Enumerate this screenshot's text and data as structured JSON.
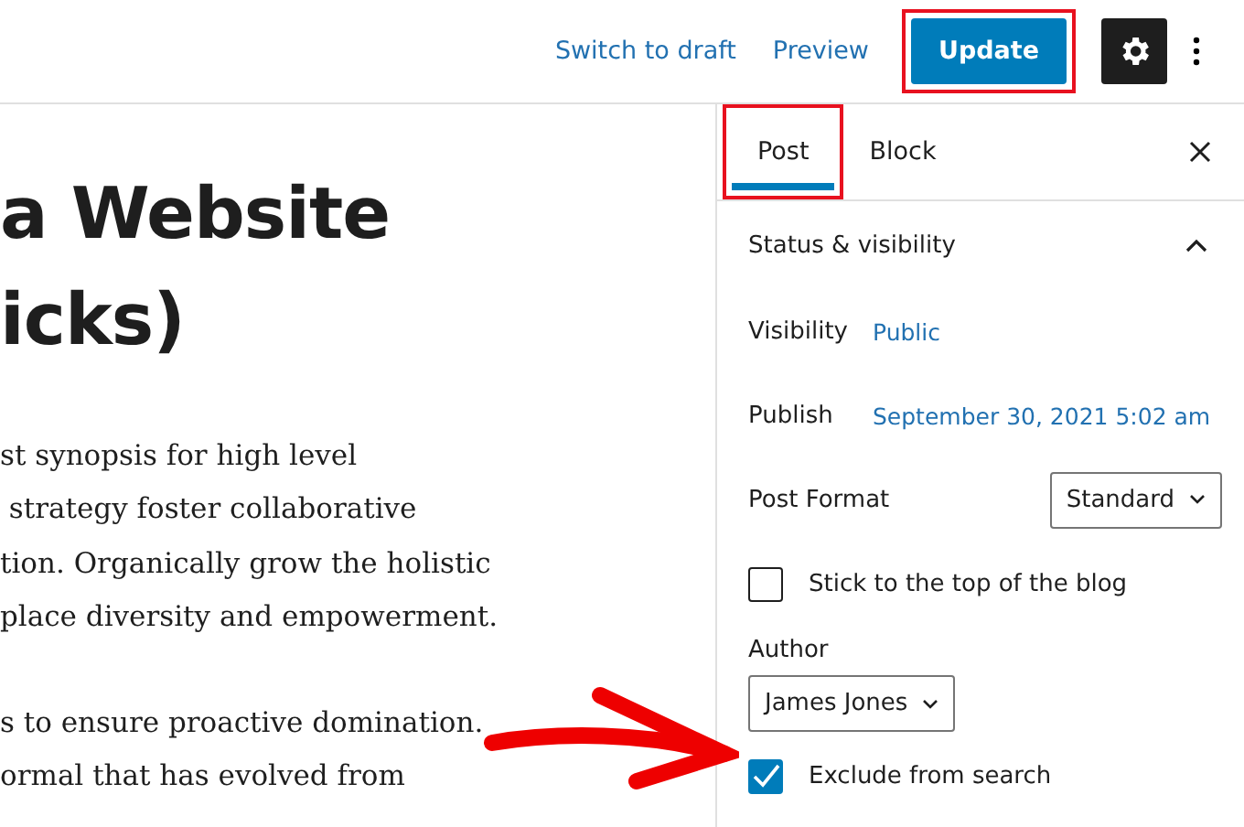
{
  "toolbar": {
    "links": [
      {
        "label": "Switch to draft"
      },
      {
        "label": "Preview"
      }
    ],
    "primary_button": {
      "label": "Update",
      "highlighted": true
    },
    "settings_button": {
      "selected": true
    }
  },
  "editor": {
    "title_lines": [
      "a Website",
      "icks)"
    ],
    "paragraphs": [
      [
        "st synopsis for high level",
        " strategy foster collaborative",
        "tion. Organically grow the holistic",
        "place diversity and empowerment."
      ],
      [
        "s to ensure proactive domination.",
        "ormal that has evolved from"
      ]
    ]
  },
  "sidebar": {
    "tabs": [
      {
        "label": "Post",
        "selected": true,
        "highlighted": true
      },
      {
        "label": "Block",
        "selected": false,
        "highlighted": false
      }
    ],
    "panel": {
      "title": "Status & visibility",
      "expanded": true,
      "rows": [
        {
          "kind": "link",
          "label": "Visibility",
          "value": "Public"
        },
        {
          "kind": "link",
          "label": "Publish",
          "value": "September 30, 2021 5:02 am"
        },
        {
          "kind": "select",
          "label": "Post Format",
          "value": "Standard"
        },
        {
          "kind": "checkbox",
          "label": "Stick to the top of the blog",
          "checked": false
        },
        {
          "kind": "stacked-select",
          "label": "Author",
          "value": "James Jones"
        },
        {
          "kind": "checkbox",
          "label": "Exclude from search",
          "checked": true
        }
      ]
    }
  }
}
